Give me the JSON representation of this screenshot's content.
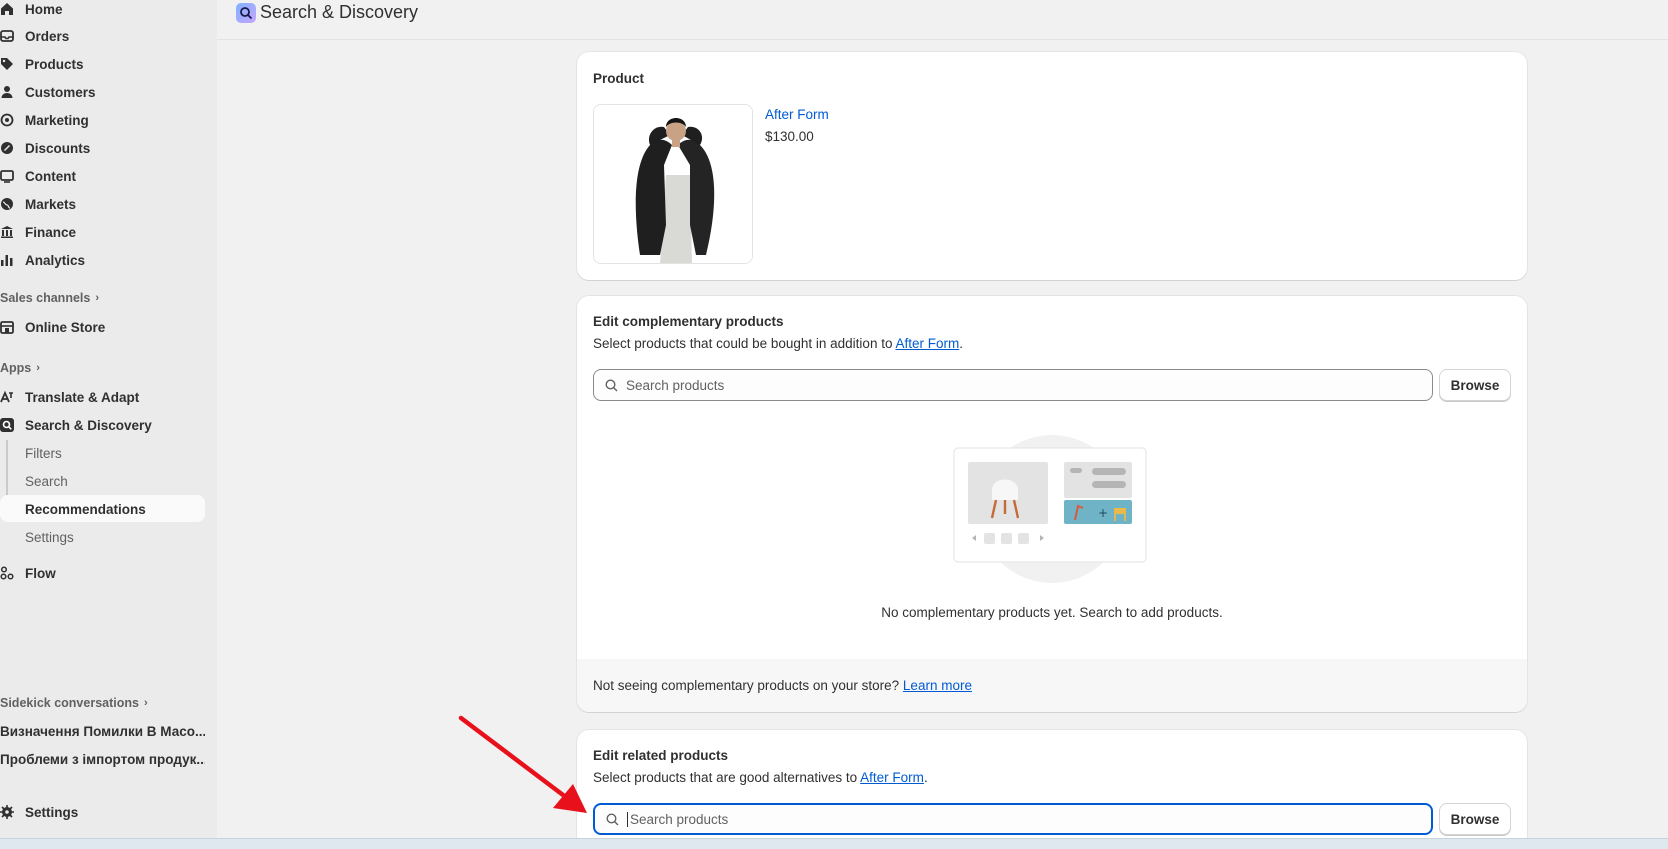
{
  "sidebar": {
    "nav": [
      {
        "label": "Home",
        "icon": "home-icon"
      },
      {
        "label": "Orders",
        "icon": "inbox-icon"
      },
      {
        "label": "Products",
        "icon": "tag-icon"
      },
      {
        "label": "Customers",
        "icon": "person-icon"
      },
      {
        "label": "Marketing",
        "icon": "target-icon"
      },
      {
        "label": "Discounts",
        "icon": "discount-icon"
      },
      {
        "label": "Content",
        "icon": "content-icon"
      },
      {
        "label": "Markets",
        "icon": "globe-icon"
      },
      {
        "label": "Finance",
        "icon": "bank-icon"
      },
      {
        "label": "Analytics",
        "icon": "bar-chart-icon"
      }
    ],
    "sales_channels_label": "Sales channels",
    "online_store": "Online Store",
    "apps_label": "Apps",
    "translate_adapt": "Translate & Adapt",
    "search_discovery": "Search & Discovery",
    "sub_items": [
      "Filters",
      "Search",
      "Recommendations",
      "Settings"
    ],
    "flow": "Flow",
    "sidekick_label": "Sidekick conversations",
    "conversations": [
      "Визначення Помилки В Масо...",
      "Проблеми з імпортом продук..."
    ],
    "settings": "Settings"
  },
  "header": {
    "title": "Search & Discovery"
  },
  "product_card": {
    "title": "Product",
    "product_name": "After Form",
    "price": "$130.00"
  },
  "complementary": {
    "title": "Edit complementary products",
    "desc_prefix": "Select products that could be bought in addition to ",
    "desc_link": "After Form",
    "desc_suffix": ".",
    "search_placeholder": "Search products",
    "browse": "Browse",
    "empty_message": "No complementary products yet. Search to add products.",
    "footer_text": "Not seeing complementary products on your store? ",
    "footer_link": "Learn more"
  },
  "related": {
    "title": "Edit related products",
    "desc_prefix": "Select products that are good alternatives to ",
    "desc_link": "After Form",
    "desc_suffix": ".",
    "search_placeholder": "Search products",
    "browse": "Browse"
  },
  "colors": {
    "accent": "#005bd3",
    "arrow": "#e8101a"
  }
}
